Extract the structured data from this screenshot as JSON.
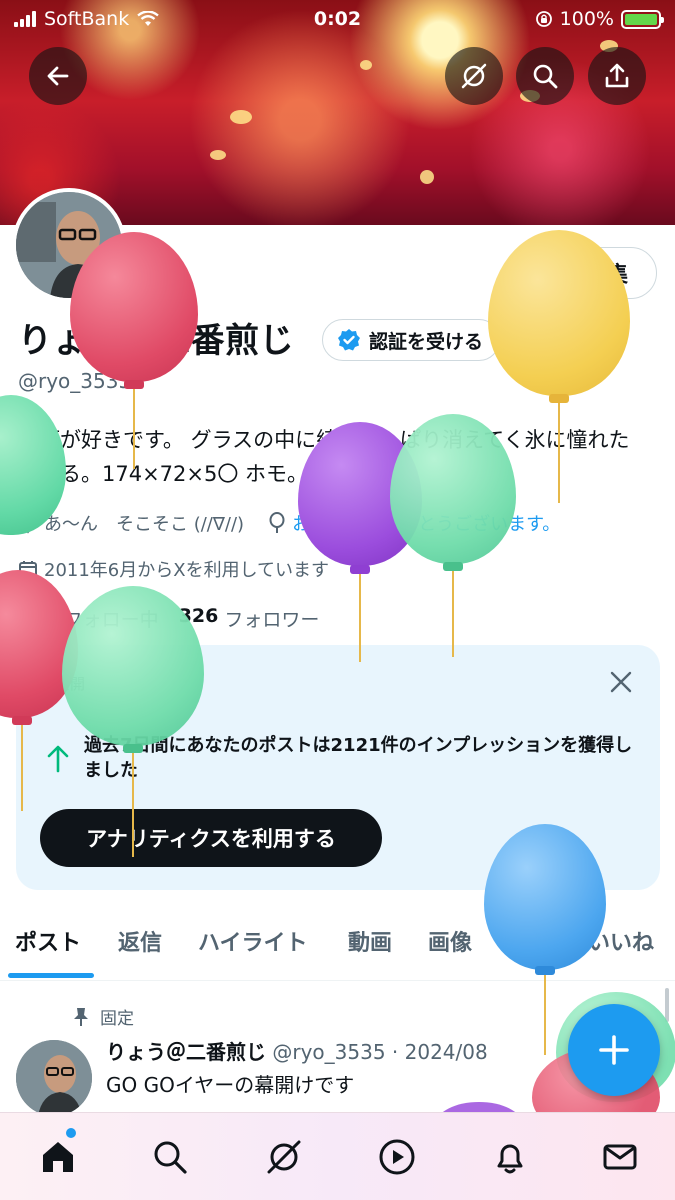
{
  "status_bar": {
    "carrier": "SoftBank",
    "time": "0:02",
    "battery": "100%"
  },
  "banner_icons": [
    "back-arrow-icon",
    "grok-icon",
    "search-icon",
    "share-icon"
  ],
  "profile": {
    "name": "りょう＠二番煎じ",
    "handle": "@ryo_3535",
    "edit_label": "編集",
    "verify_label": "認証を受ける",
    "bio": "お酒が好きです。 グラスの中に綺麗さっぱり消えてく氷に憧れたりする。174×72×5〇 ホモ。",
    "location": "あ〜ん　そこそこ (//∇//)",
    "birthday": "お誕生日おめでとうございます。",
    "joined": "2011年6月からXを利用しています",
    "following_count": "428",
    "following_label": "フォロー中",
    "followers_count": "326",
    "followers_label": "フォロワー"
  },
  "analytics_card": {
    "label": "非公開",
    "text": "過去7日間にあなたのポストは2121件のインプレッションを獲得しました",
    "button": "アナリティクスを利用する"
  },
  "tabs": [
    "ポスト",
    "返信",
    "ハイライト",
    "動画",
    "画像",
    "記事",
    "いいね"
  ],
  "active_tab": "ポスト",
  "pinned_post": {
    "pinned_label": "固定",
    "author": "りょう＠二番煎じ",
    "handle_date": "@ryo_3535 · 2024/08",
    "text": "GO GOイヤーの幕開けです"
  },
  "bottom_nav": [
    "home-icon",
    "search-icon",
    "grok-icon",
    "video-icon",
    "notifications-icon",
    "messages-icon"
  ],
  "colors": {
    "accent": "#1d9bf0",
    "text": "#0f1419",
    "muted": "#536471",
    "card_bg": "#e8f5fd"
  }
}
